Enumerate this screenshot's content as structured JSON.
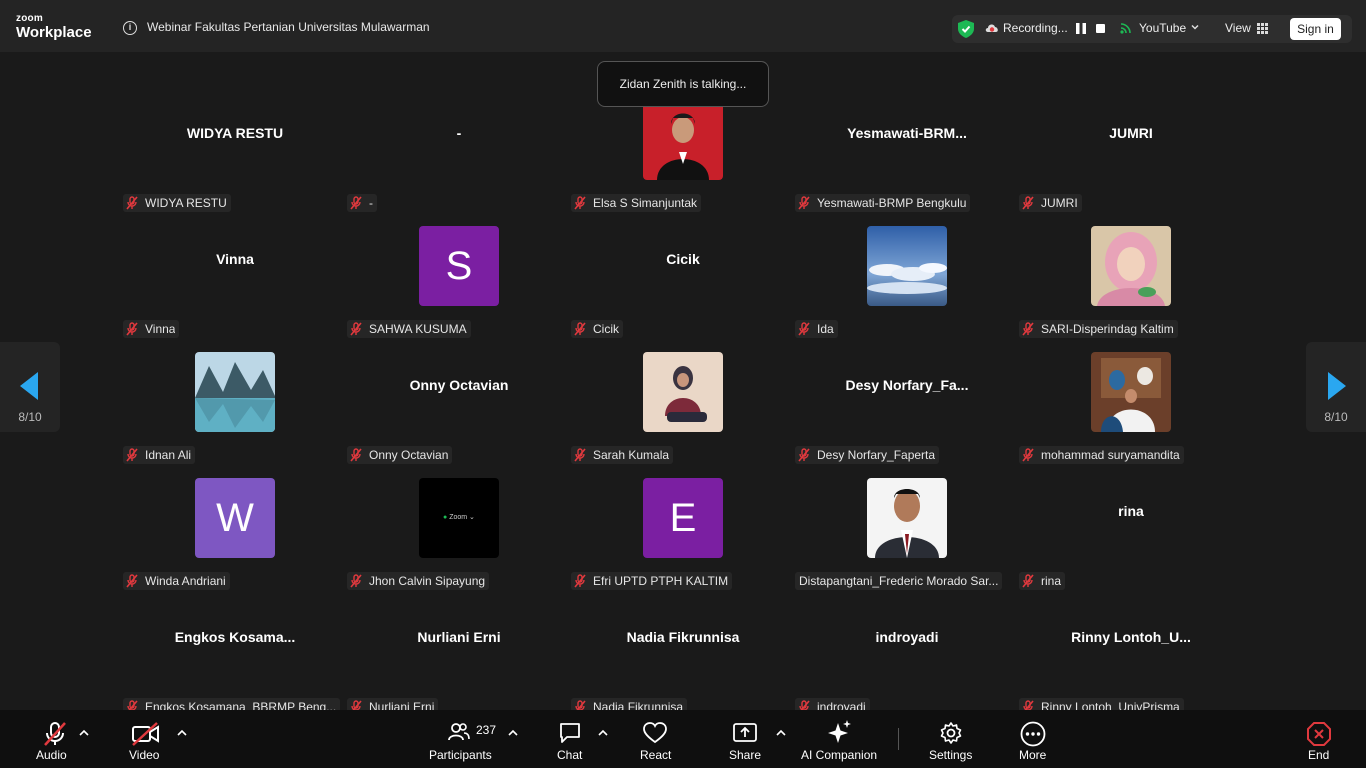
{
  "app": {
    "brand_top": "zoom",
    "brand_bottom": "Workplace"
  },
  "meeting": {
    "title": "Webinar Fakultas Pertanian Universitas Mulawarman"
  },
  "status": {
    "recording": "Recording...",
    "stream": "YouTube",
    "view": "View",
    "sign_in": "Sign in"
  },
  "talking": "Zidan Zenith is talking...",
  "paging": {
    "left": "8/10",
    "right": "8/10"
  },
  "colors": {
    "purple": "#7b1fa2",
    "lavender": "#7e57c2",
    "mic_muted": "#e0393e"
  },
  "tiles": [
    {
      "big": "WIDYA RESTU",
      "label": "WIDYA RESTU"
    },
    {
      "big": "-",
      "label": "-"
    },
    {
      "avatar": "photo-person-red",
      "label": "Elsa S Simanjuntak"
    },
    {
      "big": "Yesmawati-BRM...",
      "label": "Yesmawati-BRMP Bengkulu"
    },
    {
      "big": "JUMRI",
      "label": "JUMRI"
    },
    {
      "big": "Vinna",
      "label": "Vinna"
    },
    {
      "initial": "S",
      "label": "SAHWA KUSUMA"
    },
    {
      "big": "Cicik",
      "label": "Cicik"
    },
    {
      "avatar": "photo-clouds",
      "label": "Ida"
    },
    {
      "avatar": "photo-hijab-woman",
      "label": "SARI-Disperindag Kaltim"
    },
    {
      "avatar": "photo-lake",
      "label": "Idnan Ali"
    },
    {
      "big": "Onny Octavian",
      "label": "Onny Octavian"
    },
    {
      "avatar": "photo-woman-seated",
      "label": "Sarah Kumala"
    },
    {
      "big": "Desy  Norfary_Fa...",
      "label": "Desy Norfary_Faperta"
    },
    {
      "avatar": "photo-family",
      "label": "mohammad suryamandita"
    },
    {
      "initial": "W",
      "label": "Winda Andriani"
    },
    {
      "avatar": "zoom-black",
      "avatar_text": "Zoom",
      "label": "Jhon Calvin Sipayung"
    },
    {
      "initial": "E",
      "label": "Efri UPTD PTPH KALTIM"
    },
    {
      "avatar": "photo-man-suit",
      "label": "Distapangtani_Frederic Morado Sar..."
    },
    {
      "big": "rina",
      "label": "rina"
    },
    {
      "big": "Engkos  Kosama...",
      "label": "Engkos Kosamana_BBRMP Beng..."
    },
    {
      "big": "Nurliani Erni",
      "label": "Nurliani Erni"
    },
    {
      "big": "Nadia Fikrunnisa",
      "label": "Nadia Fikrunnisa"
    },
    {
      "big": "indroyadi",
      "label": "indroyadi"
    },
    {
      "big": "Rinny  Lontoh_U...",
      "label": "Rinny Lontoh_UnivPrisma"
    }
  ],
  "toolbar": {
    "audio": "Audio",
    "video": "Video",
    "participants": "Participants",
    "participants_count": "237",
    "chat": "Chat",
    "react": "React",
    "share": "Share",
    "ai": "AI Companion",
    "settings": "Settings",
    "more": "More",
    "end": "End"
  }
}
